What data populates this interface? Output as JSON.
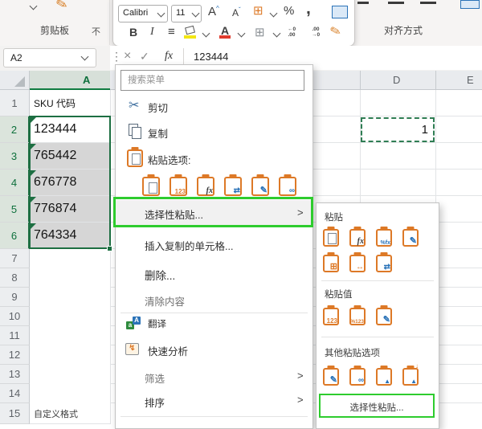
{
  "colors": {
    "excel_green": "#107C41",
    "selection_border_green": "#1d6f42",
    "highlight_green": "#2ecc2e",
    "clipboard_orange": "#dd7927",
    "accent_blue": "#2b73b8"
  },
  "ribbon": {
    "clipboard_group": "剪贴板",
    "alignment_group": "对齐方式",
    "dialog_launcher_glyph": "不"
  },
  "mini_toolbar": {
    "font_name": "Calibri",
    "font_size": "11",
    "bold": "B",
    "italic": "I",
    "grow_font": "A",
    "shrink_font": "A",
    "table_glyph": "⊞",
    "percent": "%",
    "comma": ",",
    "lines": "≡",
    "font_color_letter": "A",
    "dec_top": "←0",
    "dec_bot": ".00",
    "inc_top": ".00",
    "inc_bot": "→0",
    "brush": "✎"
  },
  "formula_bar": {
    "name_box": "A2",
    "dots": "⋮",
    "cancel": "×",
    "confirm": "✓",
    "fx": "fx",
    "value": "123444"
  },
  "sheet": {
    "col_a": "A",
    "col_d": "D",
    "col_e": "E",
    "rows": [
      "1",
      "2",
      "3",
      "4",
      "5",
      "6",
      "7",
      "8",
      "9",
      "10",
      "11",
      "12",
      "13",
      "14",
      "15"
    ],
    "a1": "SKU 代码",
    "a2": "123444",
    "a3": "765442",
    "a4": "676778",
    "a5": "776874",
    "a6": "764334",
    "a15": "自定义格式",
    "d2": "1"
  },
  "context_menu": {
    "search_placeholder": "搜索菜单",
    "cut": "剪切",
    "copy": "复制",
    "paste_options": "粘贴选项:",
    "paste_special": "选择性粘贴...",
    "insert_copied": "插入复制的单元格...",
    "delete": "删除...",
    "clear_contents": "清除内容",
    "translate": "翻译",
    "quick_analysis": "快速分析",
    "filter": "筛选",
    "sort": "排序",
    "chevron": ">"
  },
  "paste_submenu": {
    "paste": "粘贴",
    "paste_values": "粘贴值",
    "other_options": "其他粘贴选项",
    "paste_special": "选择性粘贴..."
  },
  "icon_glyphs": {
    "scissors": "✂",
    "values": "123",
    "percent_fx": "%fx",
    "percent_values": "%123",
    "fx": "fx",
    "transpose": "⇄",
    "brush": "✎",
    "link": "∞",
    "grid": "⊞",
    "keep_width": "↔",
    "picture": "▲",
    "lightning": "↯",
    "translate_a": "a",
    "translate_b": "A"
  }
}
